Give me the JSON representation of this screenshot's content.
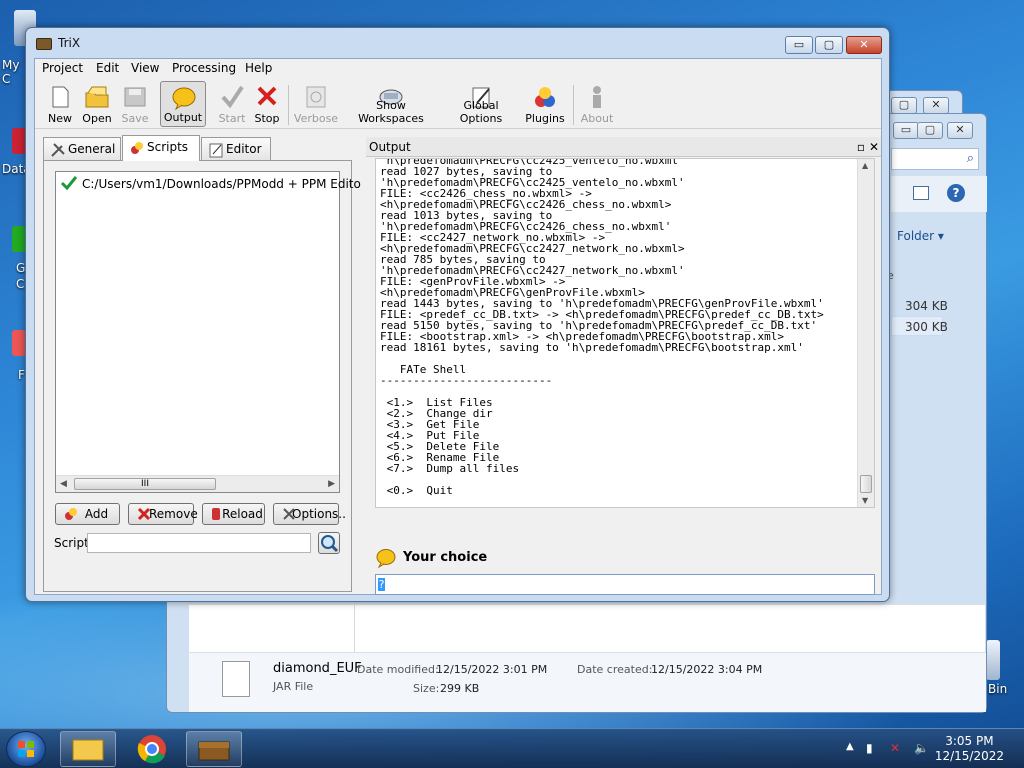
{
  "window": {
    "title": "TriX",
    "caption_buttons": {
      "minimize": "▭",
      "maximize": "▢",
      "close": "✕"
    }
  },
  "menu": [
    "Project",
    "Edit",
    "View",
    "Processing",
    "Help"
  ],
  "toolbar": {
    "new": "New",
    "open": "Open",
    "save": "Save",
    "output": "Output",
    "start": "Start",
    "stop": "Stop",
    "verbose": "Verbose",
    "show_workspaces": "Show Workspaces",
    "global_options": "Global Options",
    "plugins": "Plugins",
    "about": "About"
  },
  "left_tabs": [
    "General",
    "Scripts",
    "Editor"
  ],
  "scripts": {
    "items": [
      "C:/Users/vm1/Downloads/PPModd + PPM Edito"
    ],
    "scroll_glyph": "III",
    "buttons": {
      "add": "Add",
      "remove": "Remove",
      "reload": "Reload",
      "options": "Options.."
    },
    "script_label": "Script",
    "script_value": ""
  },
  "output": {
    "title": "Output",
    "float_glyph": "▫",
    "close_glyph": "✕",
    "lines": [
      "'h\\predefomadm\\PRECFG\\cc2425_ventelo_no.wbxml'",
      "read 1027 bytes, saving to",
      "'h\\predefomadm\\PRECFG\\cc2425_ventelo_no.wbxml'",
      "FILE: <cc2426_chess_no.wbxml> ->",
      "<h\\predefomadm\\PRECFG\\cc2426_chess_no.wbxml>",
      "read 1013 bytes, saving to",
      "'h\\predefomadm\\PRECFG\\cc2426_chess_no.wbxml'",
      "FILE: <cc2427_network_no.wbxml> ->",
      "<h\\predefomadm\\PRECFG\\cc2427_network_no.wbxml>",
      "read 785 bytes, saving to",
      "'h\\predefomadm\\PRECFG\\cc2427_network_no.wbxml'",
      "FILE: <genProvFile.wbxml> ->",
      "<h\\predefomadm\\PRECFG\\genProvFile.wbxml>",
      "read 1443 bytes, saving to 'h\\predefomadm\\PRECFG\\genProvFile.wbxml'",
      "FILE: <predef_cc_DB.txt> -> <h\\predefomadm\\PRECFG\\predef_cc_DB.txt>",
      "read 5150 bytes, saving to 'h\\predefomadm\\PRECFG\\predef_cc_DB.txt'",
      "FILE: <bootstrap.xml> -> <h\\predefomadm\\PRECFG\\bootstrap.xml>",
      "read 18161 bytes, saving to 'h\\predefomadm\\PRECFG\\bootstrap.xml'",
      "",
      "   FATe Shell",
      "--------------------------",
      "",
      " <1.>  List Files",
      " <2.>  Change dir",
      " <3.>  Get File",
      " <4.>  Put File",
      " <5.>  Delete File",
      " <6.>  Rename File",
      " <7.>  Dump all files",
      "",
      " <0.>  Quit"
    ],
    "choice_label": "Your choice",
    "choice_value": "?"
  },
  "explorer": {
    "view_menu": "Folder ▾",
    "sizes": [
      "304 KB",
      "300 KB"
    ],
    "file_name": "diamond_EUF",
    "file_type": "JAR File",
    "date_modified_label": "Date modified:",
    "date_modified": "12/15/2022 3:01 PM",
    "date_created_label": "Date created:",
    "date_created": "12/15/2022 3:04 PM",
    "size_label": "Size:",
    "size": "299 KB"
  },
  "desktop": {
    "icons": [
      "My C",
      "Data",
      "G\nC",
      "F"
    ],
    "recycle": "Bin"
  },
  "taskbar": {
    "time": "3:05 PM",
    "date": "12/15/2022"
  },
  "colors": {
    "accent": "#3399ff",
    "stop_red": "#d62020",
    "check_green": "#1a9a3a"
  }
}
